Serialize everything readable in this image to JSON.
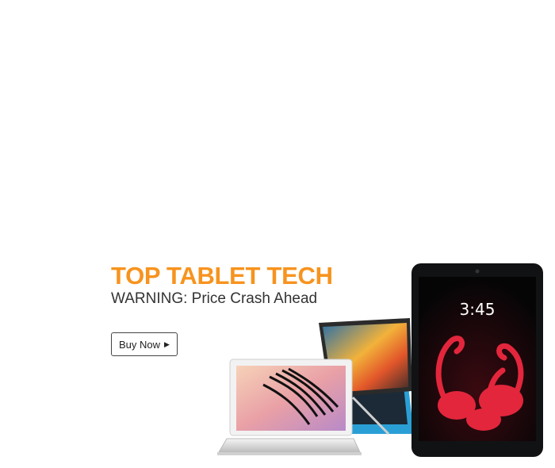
{
  "banner": {
    "headline": "TOP TABLET TECH",
    "subline": "WARNING: Price Crash Ahead",
    "cta_label": "Buy Now",
    "cta_icon": "play-arrow-icon"
  },
  "tablet_screen": {
    "clock": "3:45"
  },
  "colors": {
    "accent": "#f7931e",
    "subtext": "#333333"
  }
}
